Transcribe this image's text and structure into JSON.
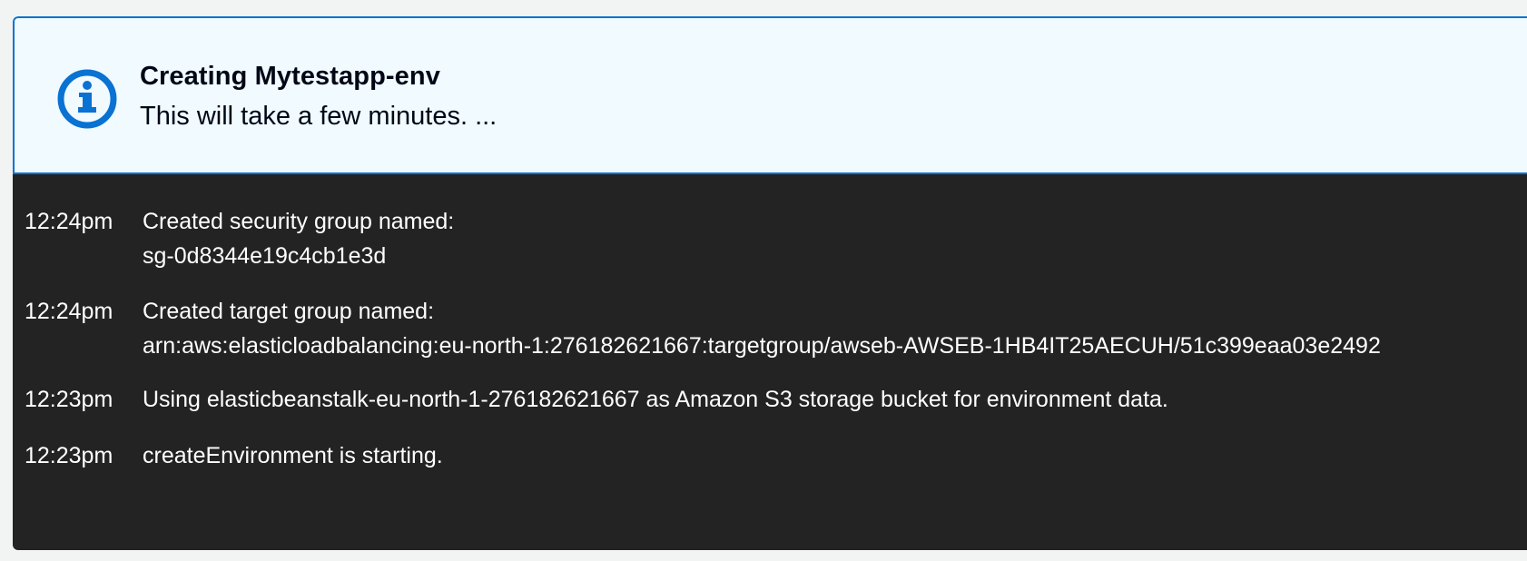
{
  "flashbar": {
    "icon": "info-icon",
    "accent_color": "#0972d3",
    "background_color": "#f1faff",
    "title": "Creating Mytestapp-env",
    "message": "This will take a few minutes. ..."
  },
  "events": [
    {
      "time": "12:24pm",
      "lines": [
        "Created security group named:",
        "sg-0d8344e19c4cb1e3d"
      ]
    },
    {
      "time": "12:24pm",
      "lines": [
        "Created target group named:",
        "arn:aws:elasticloadbalancing:eu-north-1:276182621667:targetgroup/awseb-AWSEB-1HB4IT25AECUH/51c399eaa03e2492"
      ]
    },
    {
      "time": "12:23pm",
      "lines": [
        "Using elasticbeanstalk-eu-north-1-276182621667 as Amazon S3 storage bucket for environment data."
      ]
    },
    {
      "time": "12:23pm",
      "lines": [
        "createEnvironment is starting."
      ]
    }
  ]
}
